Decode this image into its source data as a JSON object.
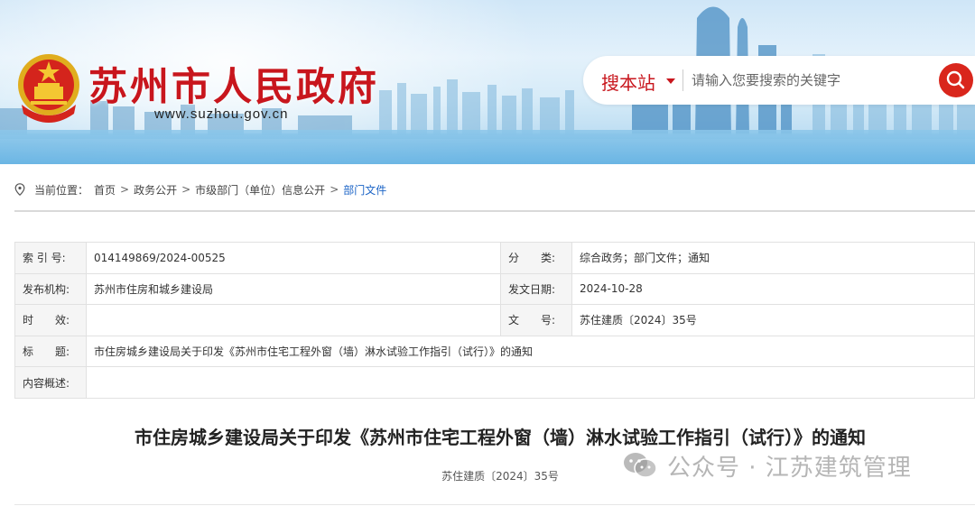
{
  "header": {
    "site_title": "苏州市人民政府",
    "site_url": "www.suzhou.gov.cn",
    "search": {
      "scope_label": "搜本站",
      "placeholder": "请输入您要搜索的关键字"
    }
  },
  "breadcrumb": {
    "prefix": "当前位置：",
    "items": [
      "首页",
      "政务公开",
      "市级部门（单位）信息公开"
    ],
    "separator": ">",
    "current": "部门文件"
  },
  "info": {
    "index_label": "索 引 号:",
    "index_value": "014149869/2024-00525",
    "category_label": "分　　类:",
    "category_value": "综合政务；部门文件；通知",
    "issuer_label": "发布机构:",
    "issuer_value": "苏州市住房和城乡建设局",
    "date_label": "发文日期:",
    "date_value": "2024-10-28",
    "validity_label": "时　　效:",
    "validity_value": "",
    "docno_label": "文　　号:",
    "docno_value": "苏住建质〔2024〕35号",
    "title_label": "标　　题:",
    "title_value": "市住房城乡建设局关于印发《苏州市住宅工程外窗（墙）淋水试验工作指引（试行）》的通知",
    "summary_label": "内容概述:",
    "summary_value": ""
  },
  "article": {
    "title": "市住房城乡建设局关于印发《苏州市住宅工程外窗（墙）淋水试验工作指引（试行）》的通知",
    "doc_number": "苏住建质〔2024〕35号"
  },
  "watermark": {
    "text": "公众号 · 江苏建筑管理"
  },
  "colors": {
    "brand_red": "#c8161d",
    "link_blue": "#1a63c6",
    "label_bg": "#f5f5f5",
    "border": "#e1e1e1"
  }
}
